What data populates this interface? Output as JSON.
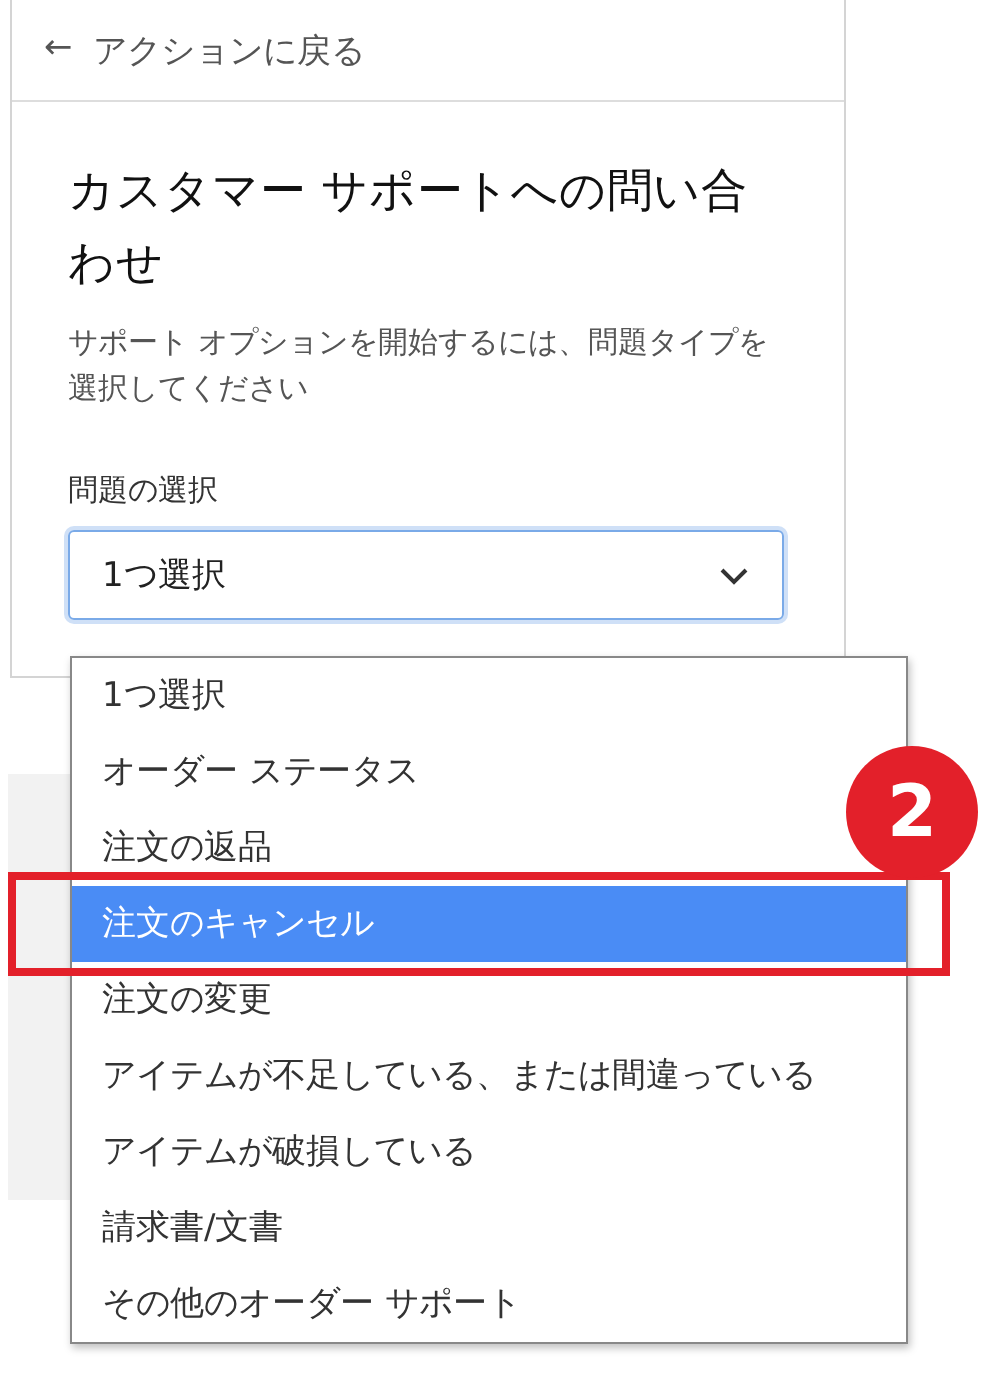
{
  "back_link": {
    "arrow": "←",
    "label": "アクションに戻る"
  },
  "title": "カスタマー サポートへの問い合わせ",
  "description": "サポート オプションを開始するには、問題タイプを選択してください",
  "issue_select": {
    "label": "問題の選択",
    "value": "1つ選択",
    "expanded": true,
    "options": [
      {
        "label": "1つ選択",
        "highlighted": false
      },
      {
        "label": "オーダー ステータス",
        "highlighted": false
      },
      {
        "label": "注文の返品",
        "highlighted": false
      },
      {
        "label": "注文のキャンセル",
        "highlighted": true
      },
      {
        "label": "注文の変更",
        "highlighted": false
      },
      {
        "label": "アイテムが不足している、または間違っている",
        "highlighted": false
      },
      {
        "label": "アイテムが破損している",
        "highlighted": false
      },
      {
        "label": "請求書/文書",
        "highlighted": false
      },
      {
        "label": "その他のオーダー サポート",
        "highlighted": false
      }
    ]
  },
  "annotation": {
    "label": "2"
  }
}
